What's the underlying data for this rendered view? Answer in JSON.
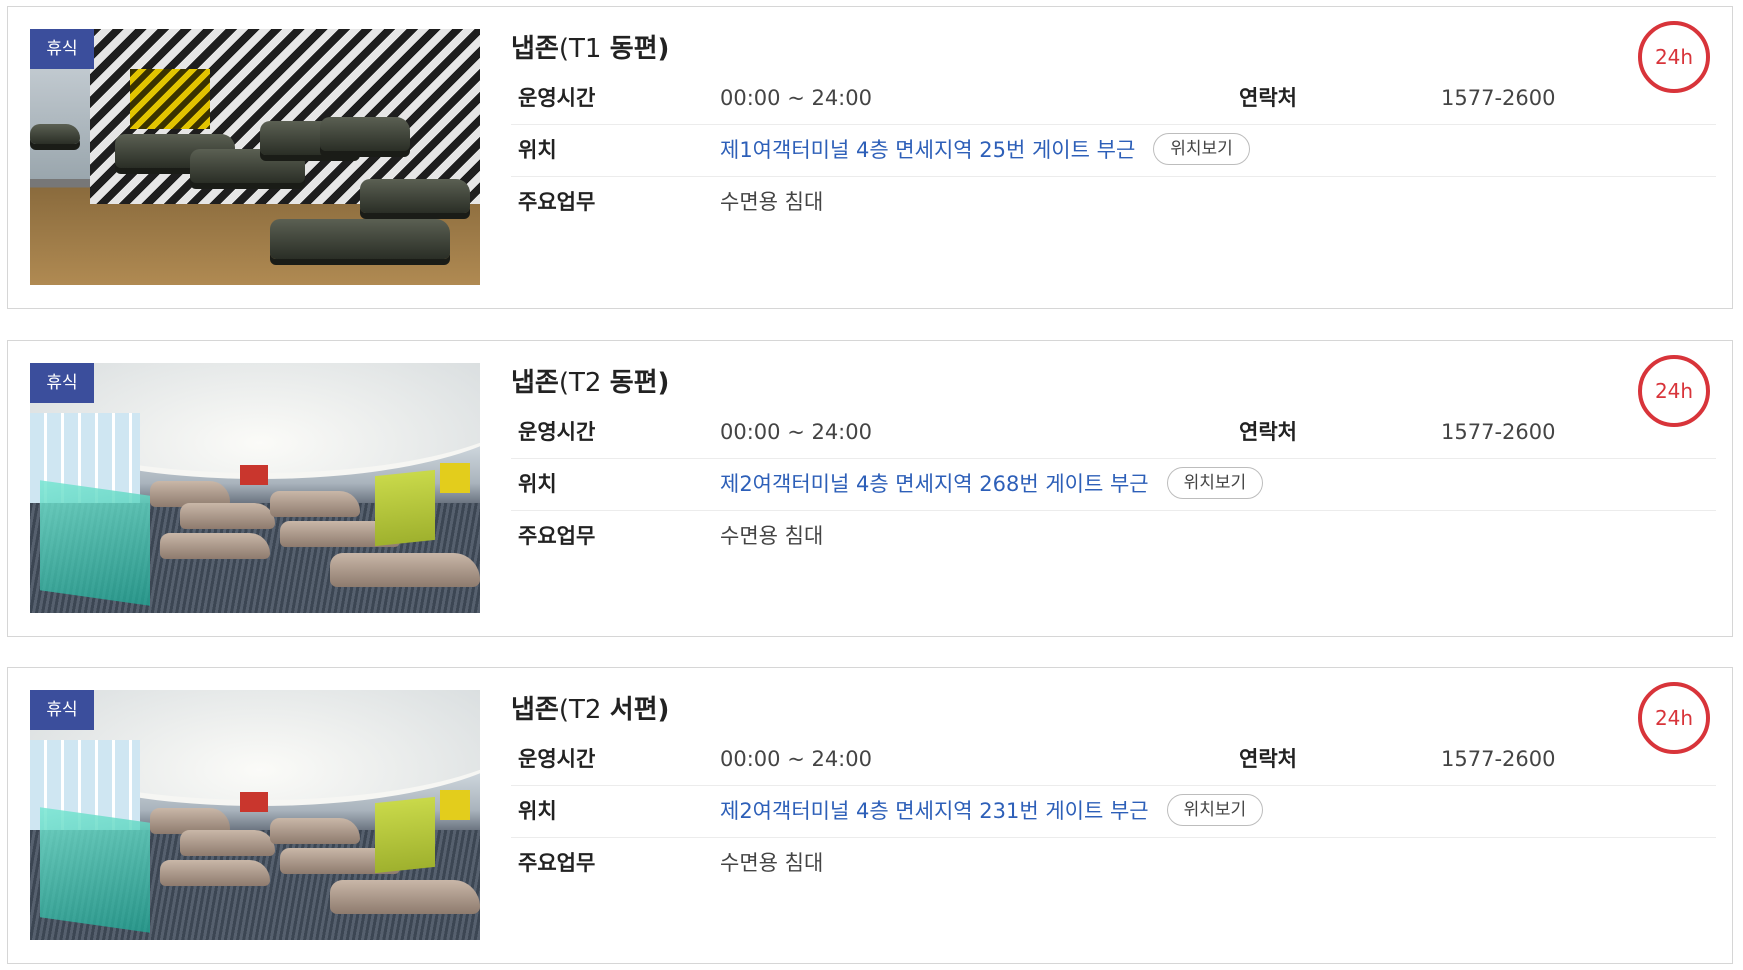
{
  "rows_labels": {
    "hours": "운영시간",
    "contact": "연락처",
    "location": "위치",
    "duty": "주요업무",
    "map_button": "위치보기"
  },
  "facilities": [
    {
      "category": "휴식",
      "name_main": "냅존",
      "name_sub": "(T1 ",
      "name_tail": "동편)",
      "hours": "00:00 ~ 24:00",
      "contact": "1577-2600",
      "location": "제1여객터미널 4층 면세지역 25번 게이트 부근",
      "duty": "수면용 침대",
      "badge_24h": "24h",
      "image_icon": "rest-area-photo-t1"
    },
    {
      "category": "휴식",
      "name_main": "냅존",
      "name_sub": "(T2 ",
      "name_tail": "동편)",
      "hours": "00:00 ~ 24:00",
      "contact": "1577-2600",
      "location": "제2여객터미널 4층 면세지역 268번 게이트 부근",
      "duty": "수면용 침대",
      "badge_24h": "24h",
      "image_icon": "rest-area-photo-t2-east"
    },
    {
      "category": "휴식",
      "name_main": "냅존",
      "name_sub": "(T2 ",
      "name_tail": "서편)",
      "hours": "00:00 ~ 24:00",
      "contact": "1577-2600",
      "location": "제2여객터미널 4층 면세지역 231번 게이트 부근",
      "duty": "수면용 침대",
      "badge_24h": "24h",
      "image_icon": "rest-area-photo-t2-west"
    }
  ],
  "colors": {
    "badge_bg": "#3b4e9c",
    "link": "#2d5fb8",
    "hours_ring": "#d8343a"
  }
}
